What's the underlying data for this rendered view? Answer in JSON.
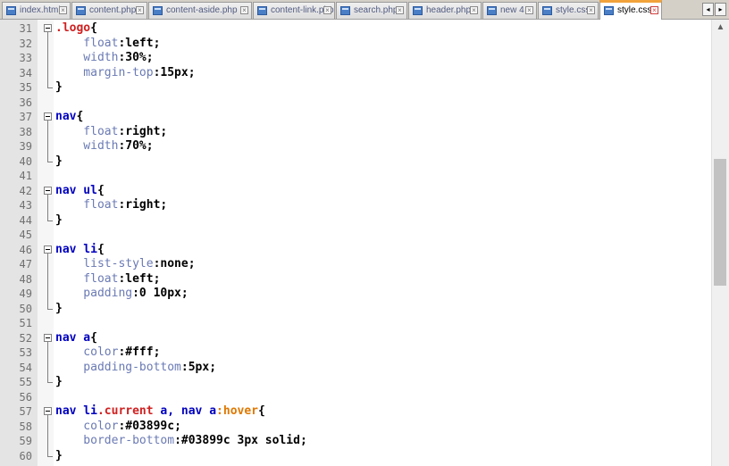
{
  "tabs": [
    {
      "label": "index.html",
      "active": false
    },
    {
      "label": "content.php",
      "active": false
    },
    {
      "label": "content-aside.php",
      "active": false
    },
    {
      "label": "content-link.php",
      "active": false
    },
    {
      "label": "search.php",
      "active": false
    },
    {
      "label": "header.php",
      "active": false
    },
    {
      "label": "new 4",
      "active": false
    },
    {
      "label": "style.css",
      "active": false
    },
    {
      "label": "style.css",
      "active": true
    }
  ],
  "icons": {
    "tab_file": "file-icon",
    "tab_close": "close-icon",
    "scroll_left": "chevron-left-icon",
    "scroll_right": "chevron-right-icon",
    "scroll_up": "chevron-up-icon"
  },
  "colors": {
    "selector": "#0000c0",
    "class": "#d02020",
    "pseudo_class": "#e07800",
    "property": "#6a7ab4",
    "value": "#000000",
    "active_tab_accent": "#f2a33b"
  },
  "editor": {
    "lines": [
      {
        "num": "31",
        "fold": "start",
        "tokens": [
          {
            "t": ".logo",
            "c": "cls"
          },
          {
            "t": "{",
            "c": "brace"
          }
        ]
      },
      {
        "num": "32",
        "fold": "body",
        "tokens": [
          {
            "t": "    float",
            "c": "prop"
          },
          {
            "t": ":left;",
            "c": "val"
          }
        ]
      },
      {
        "num": "33",
        "fold": "body",
        "tokens": [
          {
            "t": "    width",
            "c": "prop"
          },
          {
            "t": ":30%;",
            "c": "val"
          }
        ]
      },
      {
        "num": "34",
        "fold": "body",
        "tokens": [
          {
            "t": "    margin-top",
            "c": "prop"
          },
          {
            "t": ":15px;",
            "c": "val"
          }
        ]
      },
      {
        "num": "35",
        "fold": "end",
        "tokens": [
          {
            "t": "}",
            "c": "brace"
          }
        ]
      },
      {
        "num": "36",
        "fold": "none",
        "tokens": []
      },
      {
        "num": "37",
        "fold": "start",
        "tokens": [
          {
            "t": "nav",
            "c": "sel"
          },
          {
            "t": "{",
            "c": "brace"
          }
        ]
      },
      {
        "num": "38",
        "fold": "body",
        "tokens": [
          {
            "t": "    float",
            "c": "prop"
          },
          {
            "t": ":right;",
            "c": "val"
          }
        ]
      },
      {
        "num": "39",
        "fold": "body",
        "tokens": [
          {
            "t": "    width",
            "c": "prop"
          },
          {
            "t": ":70%;",
            "c": "val"
          }
        ]
      },
      {
        "num": "40",
        "fold": "end",
        "tokens": [
          {
            "t": "}",
            "c": "brace"
          }
        ]
      },
      {
        "num": "41",
        "fold": "none",
        "tokens": []
      },
      {
        "num": "42",
        "fold": "start",
        "tokens": [
          {
            "t": "nav ul",
            "c": "sel"
          },
          {
            "t": "{",
            "c": "brace"
          }
        ]
      },
      {
        "num": "43",
        "fold": "body",
        "tokens": [
          {
            "t": "    float",
            "c": "prop"
          },
          {
            "t": ":right;",
            "c": "val"
          }
        ]
      },
      {
        "num": "44",
        "fold": "end",
        "tokens": [
          {
            "t": "}",
            "c": "brace"
          }
        ]
      },
      {
        "num": "45",
        "fold": "none",
        "tokens": []
      },
      {
        "num": "46",
        "fold": "start",
        "tokens": [
          {
            "t": "nav li",
            "c": "sel"
          },
          {
            "t": "{",
            "c": "brace"
          }
        ]
      },
      {
        "num": "47",
        "fold": "body",
        "tokens": [
          {
            "t": "    list-style",
            "c": "prop"
          },
          {
            "t": ":none;",
            "c": "val"
          }
        ]
      },
      {
        "num": "48",
        "fold": "body",
        "tokens": [
          {
            "t": "    float",
            "c": "prop"
          },
          {
            "t": ":left;",
            "c": "val"
          }
        ]
      },
      {
        "num": "49",
        "fold": "body",
        "tokens": [
          {
            "t": "    padding",
            "c": "prop"
          },
          {
            "t": ":0 10px;",
            "c": "val"
          }
        ]
      },
      {
        "num": "50",
        "fold": "end",
        "tokens": [
          {
            "t": "}",
            "c": "brace"
          }
        ]
      },
      {
        "num": "51",
        "fold": "none",
        "tokens": []
      },
      {
        "num": "52",
        "fold": "start",
        "tokens": [
          {
            "t": "nav a",
            "c": "sel"
          },
          {
            "t": "{",
            "c": "brace"
          }
        ]
      },
      {
        "num": "53",
        "fold": "body",
        "tokens": [
          {
            "t": "    color",
            "c": "prop"
          },
          {
            "t": ":#fff;",
            "c": "val"
          }
        ]
      },
      {
        "num": "54",
        "fold": "body",
        "tokens": [
          {
            "t": "    padding-bottom",
            "c": "prop"
          },
          {
            "t": ":5px;",
            "c": "val"
          }
        ]
      },
      {
        "num": "55",
        "fold": "end",
        "tokens": [
          {
            "t": "}",
            "c": "brace"
          }
        ]
      },
      {
        "num": "56",
        "fold": "none",
        "tokens": []
      },
      {
        "num": "57",
        "fold": "start",
        "tokens": [
          {
            "t": "nav li",
            "c": "sel"
          },
          {
            "t": ".current",
            "c": "cls"
          },
          {
            "t": " a, nav a",
            "c": "sel"
          },
          {
            "t": ":hover",
            "c": "pseudo"
          },
          {
            "t": "{",
            "c": "brace"
          }
        ]
      },
      {
        "num": "58",
        "fold": "body",
        "tokens": [
          {
            "t": "    color",
            "c": "prop"
          },
          {
            "t": ":#03899c;",
            "c": "val"
          }
        ]
      },
      {
        "num": "59",
        "fold": "body",
        "tokens": [
          {
            "t": "    border-bottom",
            "c": "prop"
          },
          {
            "t": ":#03899c 3px solid;",
            "c": "val"
          }
        ]
      },
      {
        "num": "60",
        "fold": "end",
        "tokens": [
          {
            "t": "}",
            "c": "brace"
          }
        ]
      }
    ]
  }
}
